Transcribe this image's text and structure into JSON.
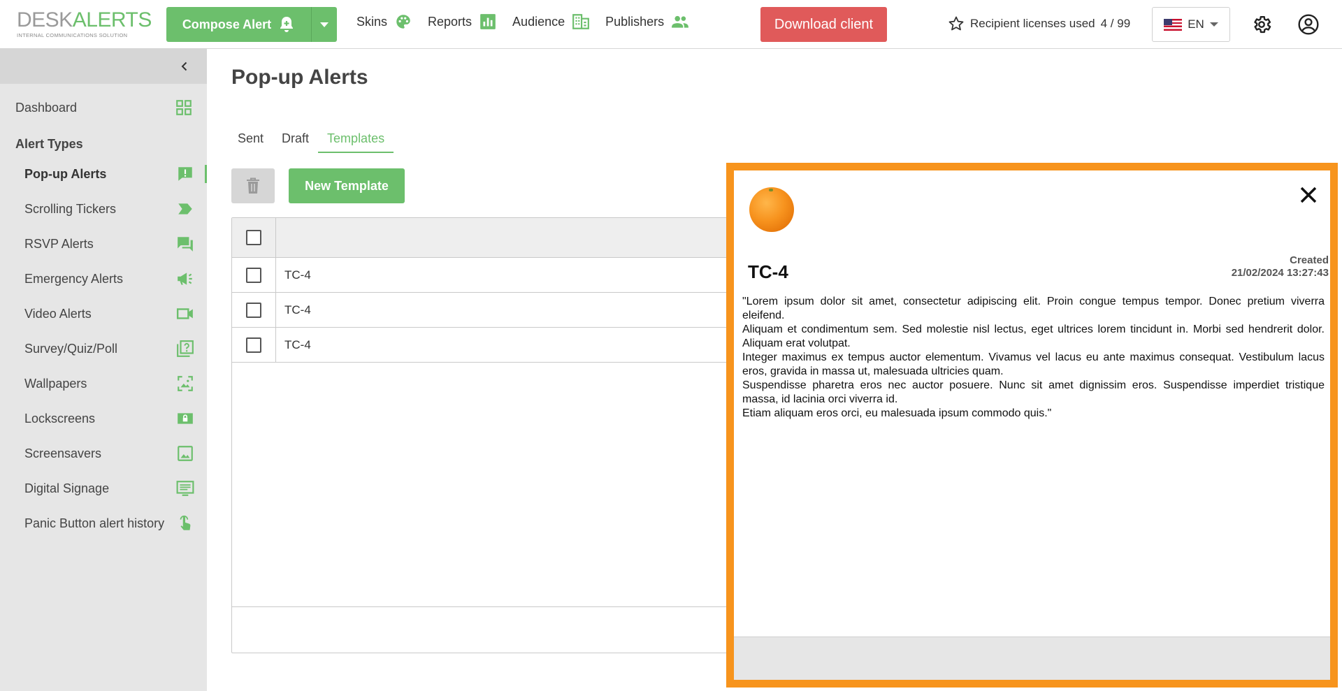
{
  "header": {
    "logo_desk": "DESK",
    "logo_alerts": "ALERTS",
    "logo_tagline": "INTERNAL COMMUNICATIONS SOLUTION",
    "compose_label": "Compose Alert",
    "nav": [
      {
        "label": "Skins",
        "icon": "palette-icon"
      },
      {
        "label": "Reports",
        "icon": "bar-chart-icon"
      },
      {
        "label": "Audience",
        "icon": "building-icon"
      },
      {
        "label": "Publishers",
        "icon": "people-icon"
      }
    ],
    "download_label": "Download client",
    "licenses_text": "Recipient licenses used",
    "licenses_value": "4 / 99",
    "language": "EN",
    "accent_color": "#6cbf6c",
    "danger_color": "#e05a5a"
  },
  "sidebar": {
    "dashboard": "Dashboard",
    "section_title": "Alert Types",
    "items": [
      {
        "label": "Pop-up Alerts",
        "icon": "popup-alert-icon",
        "active": true
      },
      {
        "label": "Scrolling Tickers",
        "icon": "ticker-icon"
      },
      {
        "label": "RSVP Alerts",
        "icon": "chat-icon"
      },
      {
        "label": "Emergency Alerts",
        "icon": "megaphone-icon"
      },
      {
        "label": "Video Alerts",
        "icon": "video-icon"
      },
      {
        "label": "Survey/Quiz/Poll",
        "icon": "survey-icon"
      },
      {
        "label": "Wallpapers",
        "icon": "wallpaper-icon"
      },
      {
        "label": "Lockscreens",
        "icon": "lockscreen-icon"
      },
      {
        "label": "Screensavers",
        "icon": "image-icon"
      },
      {
        "label": "Digital Signage",
        "icon": "signage-icon"
      },
      {
        "label": "Panic Button alert history",
        "icon": "touch-icon"
      }
    ]
  },
  "main": {
    "title": "Pop-up Alerts",
    "tabs": [
      "Sent",
      "Draft",
      "Templates"
    ],
    "active_tab": "Templates",
    "new_template_label": "New Template",
    "rows": [
      "TC-4",
      "TC-4",
      "TC-4"
    ]
  },
  "popup": {
    "title": "TC-4",
    "created_label": "Created",
    "created_value": "21/02/2024 13:27:43",
    "border_color": "#f7941d",
    "body": [
      "\"Lorem ipsum dolor sit amet, consectetur adipiscing elit. Proin congue tempus tempor. Donec pretium viverra eleifend.",
      "Aliquam et condimentum sem. Sed molestie nisl lectus, eget ultrices lorem tincidunt in. Morbi sed hendrerit dolor. Aliquam erat volutpat.",
      "Integer maximus ex tempus auctor elementum. Vivamus vel lacus eu ante maximus consequat. Vestibulum lacus eros, gravida in massa ut, malesuada ultricies quam.",
      "Suspendisse pharetra eros nec auctor posuere. Nunc sit amet dignissim eros. Suspendisse imperdiet tristique massa, id lacinia orci viverra id.",
      "Etiam aliquam eros orci, eu malesuada ipsum commodo quis.\""
    ]
  }
}
